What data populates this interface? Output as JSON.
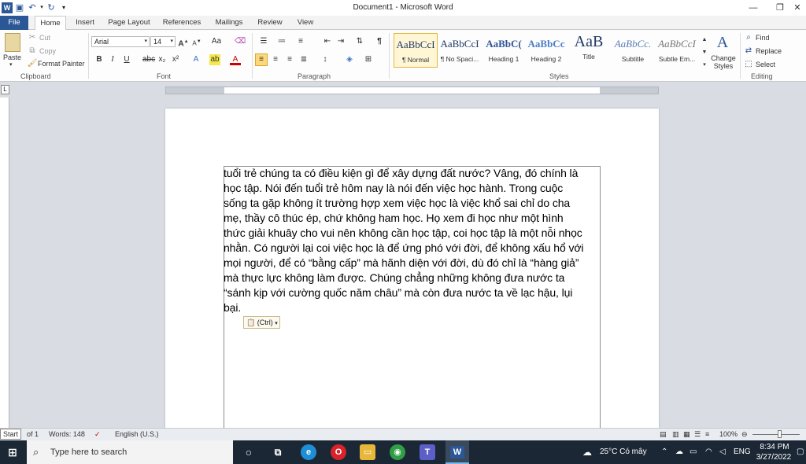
{
  "window": {
    "title": "Document1 - Microsoft Word",
    "controls": {
      "minimize": "—",
      "restore": "❐",
      "close": "✕"
    }
  },
  "ribbon_tabs": [
    "File",
    "Home",
    "Insert",
    "Page Layout",
    "References",
    "Mailings",
    "Review",
    "View"
  ],
  "clipboard": {
    "paste": "Paste",
    "cut": "Cut",
    "copy": "Copy",
    "format_painter": "Format Painter",
    "label": "Clipboard"
  },
  "font": {
    "name": "Arial",
    "size": "14",
    "label": "Font"
  },
  "paragraph": {
    "label": "Paragraph"
  },
  "styles": {
    "label": "Styles",
    "items": [
      {
        "sample": "AaBbCcI",
        "name": "¶ Normal"
      },
      {
        "sample": "AaBbCcI",
        "name": "¶ No Spaci..."
      },
      {
        "sample": "AaBbC(",
        "name": "Heading 1"
      },
      {
        "sample": "AaBbCc",
        "name": "Heading 2"
      },
      {
        "sample": "AaB",
        "name": "Title"
      },
      {
        "sample": "AaBbCc.",
        "name": "Subtitle"
      },
      {
        "sample": "AaBbCcI",
        "name": "Subtle Em..."
      }
    ],
    "change_styles": "Change Styles"
  },
  "editing": {
    "find": "Find",
    "replace": "Replace",
    "select": "Select",
    "label": "Editing"
  },
  "document": {
    "lines": [
      "tuổi trẻ chúng ta có điều kiện gì để xây dựng đất nước? Vâng, đó chính là",
      "học tập. Nói đến tuổi trẻ hôm nay là nói đến việc học hành. Trong cuộc",
      "sống ta gặp không ít trường hợp xem việc học là việc khổ sai chỉ do cha",
      "mẹ, thầy cô thúc ép, chứ không ham học. Họ xem đi học như một hình",
      "thức giải khuây cho vui nên không cần học tập, coi học tập là một nỗi nhọc",
      "nhằn. Có người lại coi việc học là để ứng phó với đời, để không xấu hổ với",
      "mọi người, để có “bằng cấp” mà hãnh diện với đời, dù đó chỉ là “hàng giả”",
      "mà thực lực không làm được. Chúng chẳng những không đưa nước ta",
      "“sánh kịp với cường quốc năm châu” mà còn đưa nước ta về lạc hậu, lụi",
      "bại."
    ],
    "paste_options": "(Ctrl)"
  },
  "status": {
    "start_tooltip": "Start",
    "page": "of 1",
    "words": "Words: 148",
    "language": "English (U.S.)",
    "zoom": "100%"
  },
  "taskbar": {
    "search_placeholder": "Type here to search",
    "weather": "25°C  Có mây",
    "language": "ENG",
    "time": "8:34 PM",
    "date": "3/27/2022"
  }
}
